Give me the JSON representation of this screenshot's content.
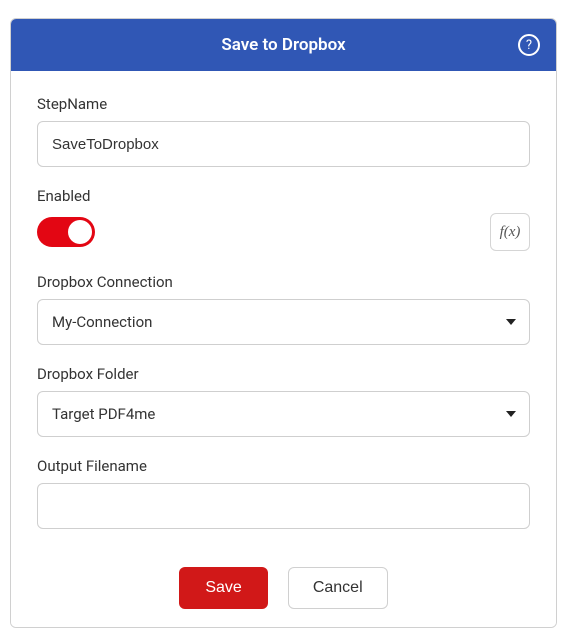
{
  "header": {
    "title": "Save to Dropbox"
  },
  "fields": {
    "stepname": {
      "label": "StepName",
      "value": "SaveToDropbox"
    },
    "enabled": {
      "label": "Enabled",
      "on": true,
      "fx": "f(x)"
    },
    "connection": {
      "label": "Dropbox Connection",
      "value": "My-Connection"
    },
    "folder": {
      "label": "Dropbox Folder",
      "value": "Target PDF4me"
    },
    "output": {
      "label": "Output Filename",
      "value": ""
    }
  },
  "buttons": {
    "save": "Save",
    "cancel": "Cancel"
  }
}
